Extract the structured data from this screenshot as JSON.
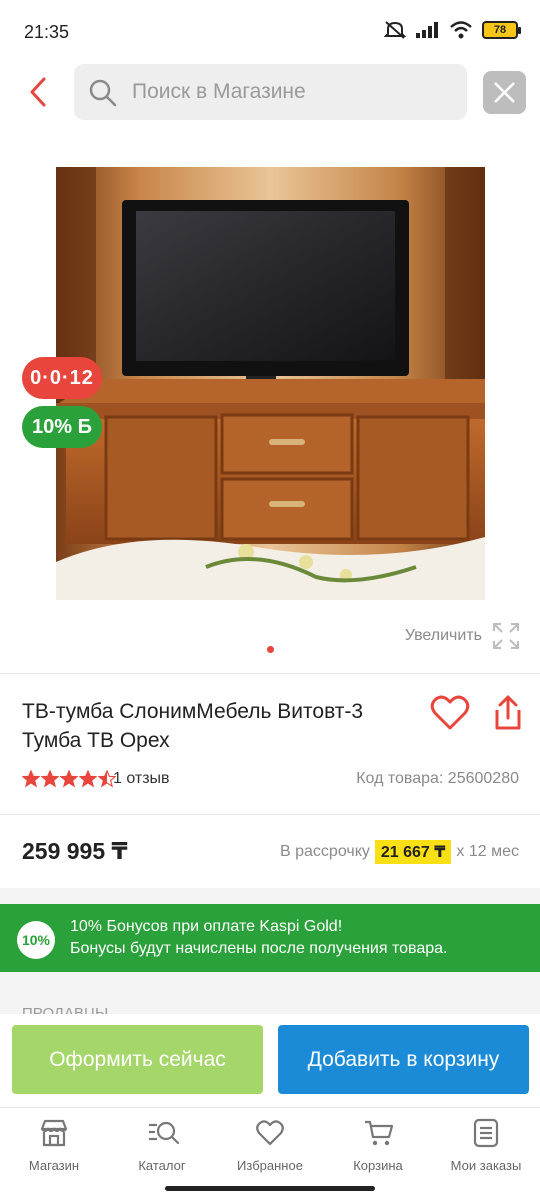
{
  "status_bar": {
    "time": "21:35",
    "battery": "78",
    "icons": [
      "mute-icon",
      "signal-icon",
      "wifi-icon",
      "battery-icon"
    ]
  },
  "header": {
    "search_placeholder": "Поиск в Магазине"
  },
  "product": {
    "image_description": "TV stand",
    "timer_badge": "0·0·12",
    "bonus_badge": "10% Б",
    "zoom_label": "Увеличить",
    "title": "ТВ-тумба СлонимМебель Витовт-3 Тумба ТВ Орех",
    "rating": 4.5,
    "reviews": "1 отзыв",
    "code": "Код товара: 25600280",
    "price": "259 995 ₸",
    "installment_prefix": "В рассрочку",
    "installment_monthly": "21 667 ₸",
    "installment_suffix": "х 12 мес"
  },
  "bonus_banner": {
    "badge": "10%",
    "line1": "10% Бонусов при оплате Kaspi Gold!",
    "line2": "Бонусы будут начислены после получения товара."
  },
  "sellers_heading": "ПРОДАВЦЫ",
  "actions": {
    "buy_now": "Оформить сейчас",
    "add_to_cart": "Добавить в корзину"
  },
  "tabbar": [
    {
      "label": "Магазин",
      "icon": "shop-icon"
    },
    {
      "label": "Каталог",
      "icon": "catalog-icon"
    },
    {
      "label": "Избранное",
      "icon": "heart-icon"
    },
    {
      "label": "Корзина",
      "icon": "cart-icon"
    },
    {
      "label": "Мои заказы",
      "icon": "orders-icon"
    }
  ],
  "colors": {
    "accent_red": "#e8453c",
    "bonus_green": "#2aa13a",
    "buy_green": "#a5d66a",
    "cart_blue": "#1b8bd8",
    "installment_yellow": "#f9e014"
  }
}
